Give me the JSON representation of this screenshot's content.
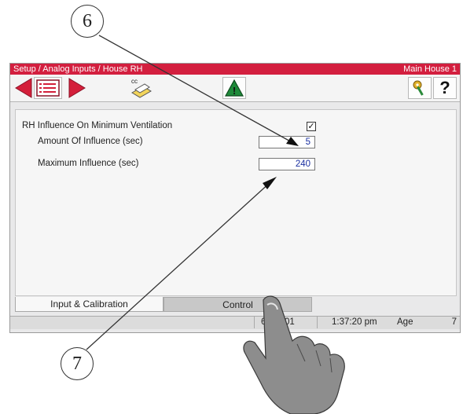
{
  "callouts": {
    "top": "6",
    "bottom": "7"
  },
  "titlebar": {
    "path": "Setup / Analog Inputs / House RH",
    "house": "Main House 1"
  },
  "toolbar": {
    "buttons": [
      {
        "name": "back-arrow-icon"
      },
      {
        "name": "list-icon"
      },
      {
        "name": "forward-arrow-icon"
      },
      {
        "name": "copy-settings-icon",
        "label": "cc"
      },
      {
        "name": "warning-icon",
        "label": "!"
      },
      {
        "name": "key-icon"
      },
      {
        "name": "help-icon",
        "label": "?"
      }
    ]
  },
  "panel": {
    "section_label": "RH Influence On Minimum Ventilation",
    "section_checked": "✓",
    "amount_label": "Amount Of Influence (sec)",
    "amount_value": "5",
    "max_label": "Maximum Influence (sec)",
    "max_value": "240"
  },
  "tabs": {
    "input": "Input & Calibration",
    "control": "Control"
  },
  "status": {
    "date_fragment": "6",
    "date_fragment2": "201",
    "time": "1:37:20 pm",
    "age_label": "Age",
    "age_value": "7"
  },
  "colors": {
    "titlebar": "#d31f3f",
    "arrow": "#d41f3a",
    "warning": "#1e8a3a",
    "value_text": "#1a2fa0"
  }
}
